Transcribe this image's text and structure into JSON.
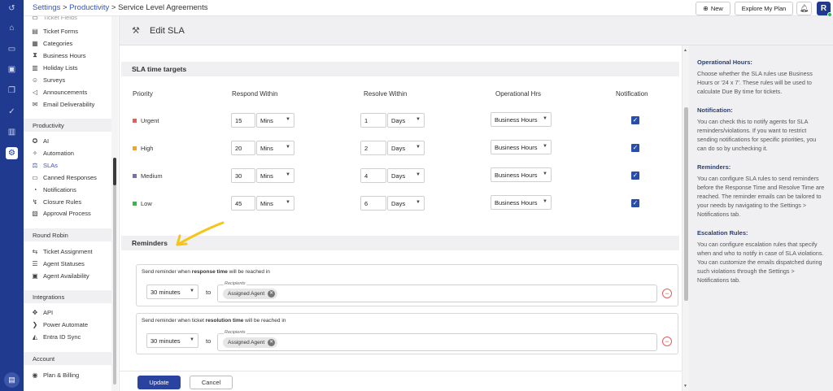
{
  "topbar": {
    "breadcrumb_settings": "Settings",
    "breadcrumb_sep1": " > ",
    "breadcrumb_productivity": "Productivity",
    "breadcrumb_sep2": " > ",
    "breadcrumb_current": "Service Level Agreements",
    "new_label": "New",
    "explore_label": "Explore My Plan",
    "avatar_initial": "R"
  },
  "sidebar": {
    "top_items": [
      {
        "label": "Ticket Forms",
        "icon": "form-icon"
      },
      {
        "label": "Categories",
        "icon": "categories-icon"
      },
      {
        "label": "Business Hours",
        "icon": "hourglass-icon"
      },
      {
        "label": "Holiday Lists",
        "icon": "list-icon"
      },
      {
        "label": "Surveys",
        "icon": "survey-icon"
      },
      {
        "label": "Announcements",
        "icon": "megaphone-icon"
      },
      {
        "label": "Email Deliverability",
        "icon": "email-icon"
      }
    ],
    "productivity_title": "Productivity",
    "productivity_items": [
      {
        "label": "AI",
        "icon": "ai-icon"
      },
      {
        "label": "Automation",
        "icon": "automation-icon"
      },
      {
        "label": "SLAs",
        "icon": "sla-icon"
      },
      {
        "label": "Canned Responses",
        "icon": "canned-icon"
      },
      {
        "label": "Notifications",
        "icon": "bell-icon"
      },
      {
        "label": "Closure Rules",
        "icon": "closure-icon"
      },
      {
        "label": "Approval Process",
        "icon": "approval-icon"
      }
    ],
    "round_robin_title": "Round Robin",
    "round_robin_items": [
      {
        "label": "Ticket Assignment",
        "icon": "assign-icon"
      },
      {
        "label": "Agent Statuses",
        "icon": "status-icon"
      },
      {
        "label": "Agent Availability",
        "icon": "availability-icon"
      }
    ],
    "integrations_title": "Integrations",
    "integrations_items": [
      {
        "label": "API",
        "icon": "api-icon"
      },
      {
        "label": "Power Automate",
        "icon": "power-automate-icon"
      },
      {
        "label": "Entra ID Sync",
        "icon": "entra-icon"
      }
    ],
    "account_title": "Account",
    "account_items": [
      {
        "label": "Plan & Billing",
        "icon": "billing-icon"
      }
    ]
  },
  "page": {
    "title": "Edit SLA",
    "targets_heading": "SLA time targets",
    "col_priority": "Priority",
    "col_respond": "Respond Within",
    "col_resolve": "Resolve Within",
    "col_ophrs": "Operational Hrs",
    "col_notification": "Notification",
    "rows": [
      {
        "priority": "Urgent",
        "color": "#e0605c",
        "respond_value": "15",
        "respond_unit": "Mins",
        "resolve_value": "1",
        "resolve_unit": "Days",
        "op_hours": "Business Hours",
        "notify": true
      },
      {
        "priority": "High",
        "color": "#f2a52b",
        "respond_value": "20",
        "respond_unit": "Mins",
        "resolve_value": "2",
        "resolve_unit": "Days",
        "op_hours": "Business Hours",
        "notify": true
      },
      {
        "priority": "Medium",
        "color": "#7a6fa8",
        "respond_value": "30",
        "respond_unit": "Mins",
        "resolve_value": "4",
        "resolve_unit": "Days",
        "op_hours": "Business Hours",
        "notify": true
      },
      {
        "priority": "Low",
        "color": "#3bb54a",
        "respond_value": "45",
        "respond_unit": "Mins",
        "resolve_value": "6",
        "resolve_unit": "Days",
        "op_hours": "Business Hours",
        "notify": true
      }
    ],
    "reminders_heading": "Reminders",
    "reminders": [
      {
        "label_pre": "Send reminder when ",
        "label_bold": "response time",
        "label_post": " will be reached in",
        "time": "30 minutes",
        "to": "to",
        "recipients_caption": "Recipients",
        "chip": "Assigned Agent"
      },
      {
        "label_pre": "Send reminder when ticket ",
        "label_bold": "resolution time",
        "label_post": " will be reached in",
        "time": "30 minutes",
        "to": "to",
        "recipients_caption": "Recipients",
        "chip": "Assigned Agent"
      }
    ],
    "update_label": "Update",
    "cancel_label": "Cancel"
  },
  "help": [
    {
      "title": "Operational Hours:",
      "body": "Choose whether the SLA rules use Business Hours or '24 x 7'. These rules will be used to calculate Due By time for tickets."
    },
    {
      "title": "Notification:",
      "body": "You can check this to notify agents for SLA reminders/violations. If you want to restrict sending notifications for specific priorities, you can do so by unchecking it."
    },
    {
      "title": "Reminders:",
      "body": "You can configure SLA rules to send reminders before the Response Time and Resolve Time are reached. The reminder emails can be tailored to your needs by navigating to the Settings > Notifications tab."
    },
    {
      "title": "Escalation Rules:",
      "body": "You can configure escalation rules that specify when and who to notify in case of SLA violations. You can customize the emails dispatched during such violations through the Settings > Notifications tab."
    }
  ],
  "colors": {
    "rail": "#1f3a8f",
    "accent": "#2f55c9",
    "primary_button": "#2a43a0",
    "checkbox": "#2a4ea8",
    "annotation_arrow": "#f5c518"
  }
}
